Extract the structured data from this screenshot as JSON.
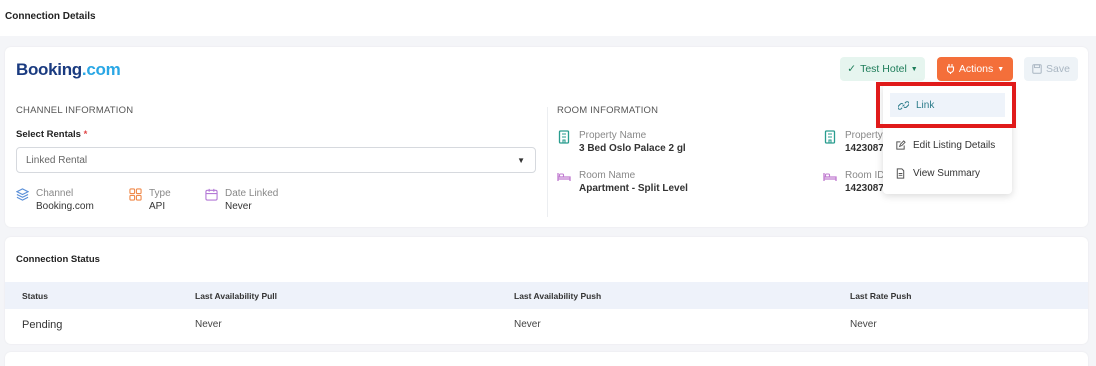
{
  "page": {
    "title": "Connection Details"
  },
  "header": {
    "brand_part1": "Booking",
    "brand_part2": ".com",
    "hotel_button": "Test Hotel",
    "actions_button": "Actions",
    "save_button": "Save"
  },
  "channel": {
    "section_title": "CHANNEL INFORMATION",
    "select_label": "Select Rentals",
    "select_required": "*",
    "select_value": "Linked Rental",
    "meta": [
      {
        "key": "Channel",
        "value": "Booking.com",
        "icon": "layers-icon"
      },
      {
        "key": "Type",
        "value": "API",
        "icon": "grid-icon"
      },
      {
        "key": "Date Linked",
        "value": "Never",
        "icon": "calendar-icon"
      }
    ]
  },
  "room": {
    "section_title": "ROOM INFORMATION",
    "items": [
      {
        "key": "Property Name",
        "value": "3 Bed Oslo Palace 2 gl",
        "icon": "building-icon"
      },
      {
        "key": "Property",
        "value": "1423087",
        "icon": "building-icon"
      },
      {
        "key": "Room Name",
        "value": "Apartment - Split Level",
        "icon": "bed-icon"
      },
      {
        "key": "Room ID",
        "value": "1423087",
        "icon": "bed-icon"
      }
    ]
  },
  "actions_menu": {
    "items": [
      {
        "label": "Link",
        "icon": "link-icon"
      },
      {
        "label": "Edit Listing Details",
        "icon": "edit-icon"
      },
      {
        "label": "View Summary",
        "icon": "document-icon"
      }
    ]
  },
  "status": {
    "title": "Connection Status",
    "columns": [
      "Status",
      "Last Availability Pull",
      "Last Availability Push",
      "Last Rate Push"
    ],
    "row": [
      "Pending",
      "Never",
      "Never",
      "Never"
    ]
  },
  "colors": {
    "accent_orange": "#f46f3a",
    "hotel_green": "#1e7d5a",
    "highlight_red": "#e01a1a",
    "brand_dark": "#1a3b80",
    "brand_light": "#2aa7e5"
  }
}
